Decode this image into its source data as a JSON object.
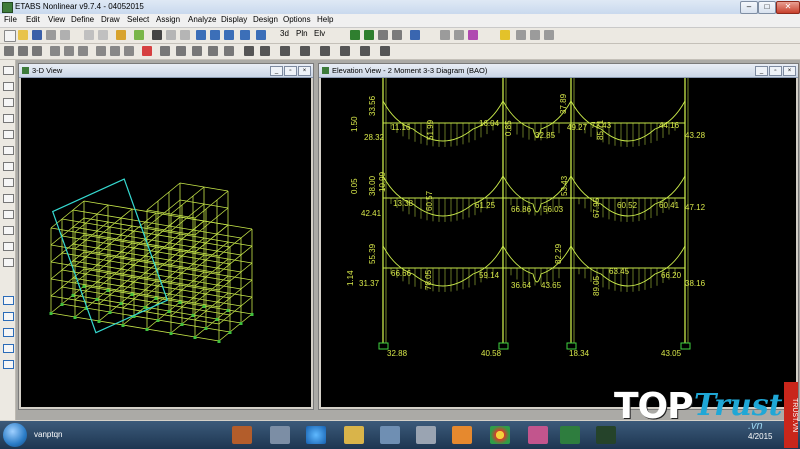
{
  "app": {
    "title": "ETABS Nonlinear v9.7.4 - 04052015",
    "window_buttons": {
      "minimize": "–",
      "maximize": "□",
      "close": "✕"
    }
  },
  "menu": [
    "File",
    "Edit",
    "View",
    "Define",
    "Draw",
    "Select",
    "Assign",
    "Analyze",
    "Display",
    "Design",
    "Options",
    "Help"
  ],
  "toolbar": {
    "view_3d": "3d",
    "plan": "Pln",
    "elev": "Elv"
  },
  "windows": {
    "left": {
      "title": "3-D View"
    },
    "right": {
      "title": "Elevation View - 2    Moment 3-3 Diagram    (BAO)"
    }
  },
  "moments": {
    "values": [
      "33.56",
      "1.50",
      "28.32",
      "11.16",
      "16.04",
      "51.99",
      "0.85",
      "32.85",
      "49.27",
      "37.89",
      "73.43",
      "85.71",
      "44.16",
      "43.28",
      "38.00",
      "10.99",
      "0.05",
      "42.41",
      "13.38",
      "60.57",
      "61.25",
      "66.86",
      "56.03",
      "53.43",
      "67.95",
      "60.52",
      "60.41",
      "47.12",
      "55.39",
      "1.14",
      "31.37",
      "66.66",
      "78.05",
      "59.14",
      "36.64",
      "43.65",
      "82.29",
      "63.45",
      "89.05",
      "66.20",
      "38.16",
      "32.88",
      "40.58",
      "18.34",
      "43.05"
    ]
  },
  "taskbar": {
    "user": "vanptqn"
  },
  "watermark": {
    "brand_top": "TOP",
    "brand_trust": "Trust",
    "brand_vn": ".vn",
    "date": "4/2015",
    "side": "TRUST.VN"
  },
  "colors": {
    "frame": "#c8e84a",
    "brace": "#35d9d0",
    "text": "#d8e84a",
    "bg": "#000000"
  }
}
